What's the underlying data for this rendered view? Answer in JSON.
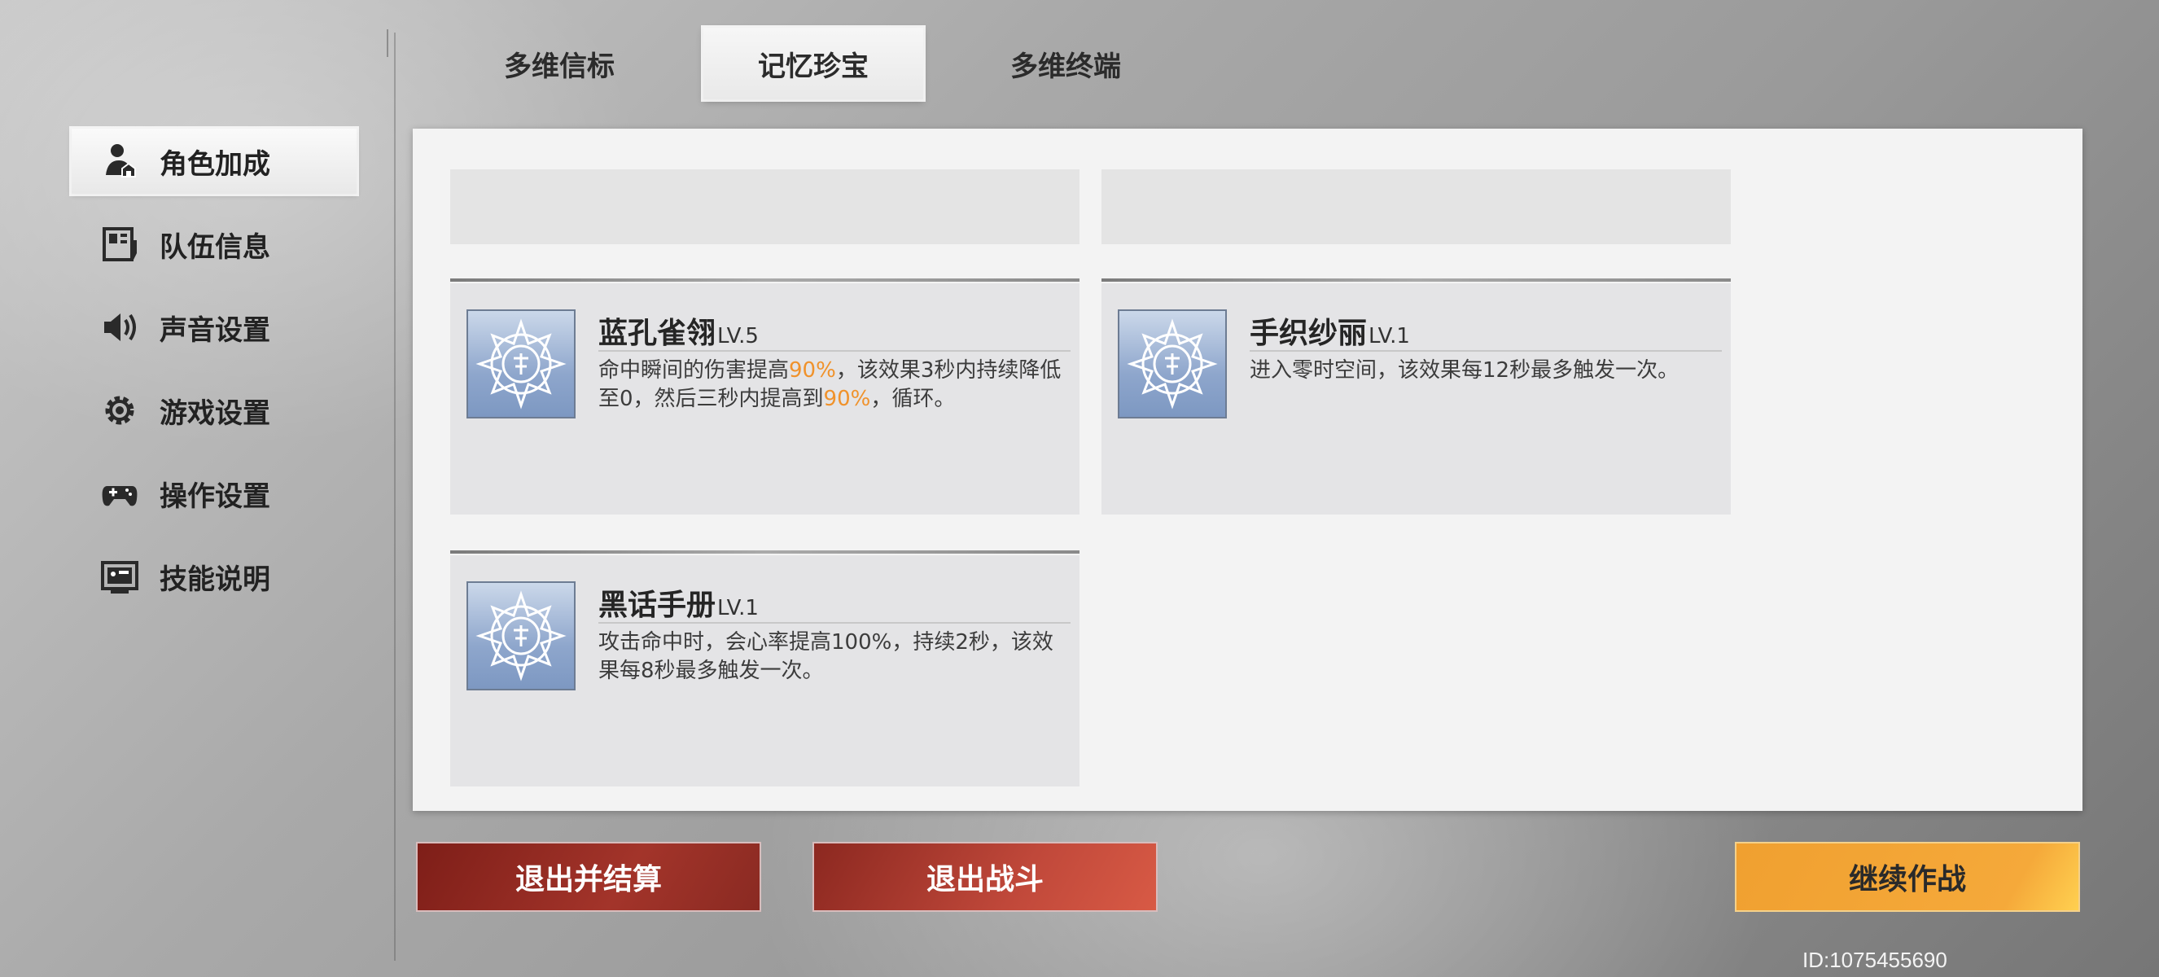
{
  "tabs": [
    {
      "label": "多维信标",
      "active": false
    },
    {
      "label": "记忆珍宝",
      "active": true
    },
    {
      "label": "多维终端",
      "active": false
    }
  ],
  "sidebar": {
    "items": [
      {
        "label": "角色加成",
        "icon": "character-icon",
        "active": true
      },
      {
        "label": "队伍信息",
        "icon": "team-icon",
        "active": false
      },
      {
        "label": "声音设置",
        "icon": "speaker-icon",
        "active": false
      },
      {
        "label": "游戏设置",
        "icon": "gear-icon",
        "active": false
      },
      {
        "label": "操作设置",
        "icon": "gamepad-icon",
        "active": false
      },
      {
        "label": "技能说明",
        "icon": "skill-card-icon",
        "active": false
      }
    ]
  },
  "treasures": [
    {
      "name": "蓝孔雀翎",
      "level": "LV.5",
      "desc_parts": [
        "命中瞬间的伤害提高",
        "90%",
        "，该效果3秒内持续降低至0，然后三秒内提高到",
        "90%",
        "，循环。"
      ]
    },
    {
      "name": "手织纱丽",
      "level": "LV.1",
      "desc_parts": [
        "进入零时空间，该效果每12秒最多触发一次。"
      ]
    },
    {
      "name": "黑话手册",
      "level": "LV.1",
      "desc_parts": [
        "攻击命中时，会心率提高100%，持续2秒，该效果每8秒最多触发一次。"
      ]
    }
  ],
  "buttons": {
    "exit_settle": "退出并结算",
    "exit_battle": "退出战斗",
    "continue": "继续作战"
  },
  "user_id": "ID:1075455690",
  "colors": {
    "highlight": "#f0922b",
    "exit_button": "#a3342a",
    "continue_button": "#f5a93a"
  }
}
